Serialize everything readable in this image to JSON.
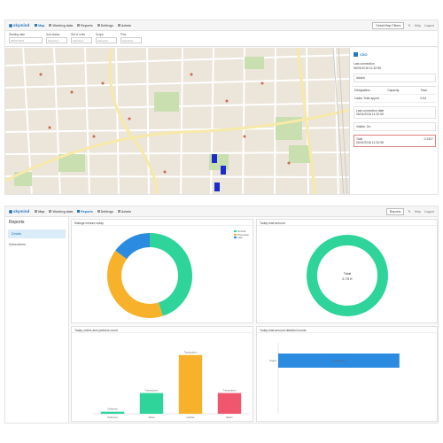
{
  "app": {
    "logo_text": "skymind",
    "nav": [
      "Map",
      "Working data",
      "Reports",
      "Settings",
      "Admin"
    ],
    "tab_select": "Detail Map Filters",
    "right_items": [
      "Tr",
      "Help",
      "Logout"
    ]
  },
  "filters": [
    {
      "label": "Starting date",
      "value": "05/01/2016"
    },
    {
      "label": "Sub-status",
      "value": "Selection"
    },
    {
      "label": "Set of units",
      "value": "Selection"
    },
    {
      "label": "Scope",
      "value": "Selection"
    },
    {
      "label": "Pins",
      "value": "Selection"
    }
  ],
  "right_panel": {
    "title": "CSO",
    "intro": [
      "Last connection",
      "05/01/2016 11:32:55"
    ],
    "status_chip": "Added",
    "table_headers": [
      "Designation",
      "Capacity",
      "Total"
    ],
    "table_rows": [
      [
        "Cadre Total apport",
        "",
        "0.64"
      ]
    ],
    "info_lines": [
      "Last connection date",
      "05/01/2016 11:32:55"
    ],
    "status_line": "Visible: On",
    "highlight_lines": [
      "Total",
      "05/01/2016 11:32:55"
    ],
    "highlight_value": "0.2327"
  },
  "reports": {
    "sidebar_title": "Reports",
    "sidebar_items": [
      "Details",
      "Subscribers"
    ],
    "tab_select": "Reports",
    "panels": {
      "donut1": {
        "title": "Ratings mixture today"
      },
      "donut2": {
        "title": "Today total amount"
      },
      "bar_v": {
        "title": "Today orders and partners count"
      },
      "bar_h": {
        "title": "Today total amount detailed counts"
      }
    }
  },
  "colors": {
    "primary": "#2a79c0",
    "green": "#2ed49a",
    "orange": "#f7b12a",
    "blue": "#2a8be0",
    "red": "#f0566e"
  },
  "chart_data": [
    {
      "type": "pie",
      "title": "Ratings mixture today",
      "labels": [
        "Normal",
        "Promotion",
        "Late"
      ],
      "values": [
        45,
        40,
        15
      ],
      "colors": [
        "#2ed49a",
        "#f7b12a",
        "#2a8be0"
      ],
      "legend": "top-right"
    },
    {
      "type": "pie",
      "title": "Today total amount",
      "labels": [
        "Total"
      ],
      "values": [
        100
      ],
      "center_label": "Total",
      "center_value": "2.75 K",
      "colors": [
        "#2ed49a"
      ]
    },
    {
      "type": "bar",
      "title": "Today orders and partners count",
      "categories": [
        "Delivered",
        "Active",
        "Inactive",
        "Return"
      ],
      "values": [
        0.3,
        3,
        8.5,
        3
      ],
      "data_labels": [
        "Delivered",
        "Transactions",
        "Transactions",
        "Transactions"
      ],
      "colors": [
        "#2ed49a",
        "#2ed49a",
        "#f7b12a",
        "#f0566e"
      ],
      "ylim": [
        0,
        10
      ]
    },
    {
      "type": "bar",
      "orientation": "horizontal",
      "title": "Today total amount detailed counts",
      "categories": [
        "Orders"
      ],
      "values": [
        8
      ],
      "data_labels": [
        "Transactions"
      ],
      "colors": [
        "#2a8be0"
      ],
      "xlim": [
        0,
        10
      ]
    }
  ]
}
